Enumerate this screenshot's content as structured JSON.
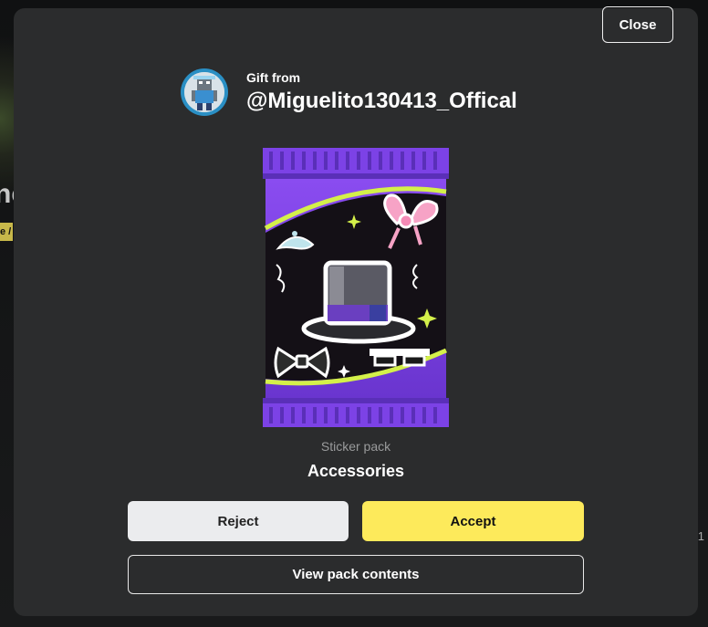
{
  "modal": {
    "close_label": "Close",
    "gift_from_label": "Gift from",
    "sender_username": "@Miguelito130413_Offical",
    "pack_type": "Sticker pack",
    "pack_name": "Accessories",
    "reject_label": "Reject",
    "accept_label": "Accept",
    "view_contents_label": "View pack contents"
  },
  "colors": {
    "modal_bg": "#2b2c2d",
    "accept": "#fdea5b",
    "reject": "#ebecee",
    "pack_purple": "#7b3fe0",
    "pack_ribbon": "#d4f04a"
  },
  "icons": {
    "avatar": "user-avatar-icon",
    "pack_art": [
      "top-hat-icon",
      "bow-icon",
      "bowtie-icon",
      "tiara-icon",
      "pixel-sunglasses-icon",
      "sparkle-icon"
    ]
  }
}
